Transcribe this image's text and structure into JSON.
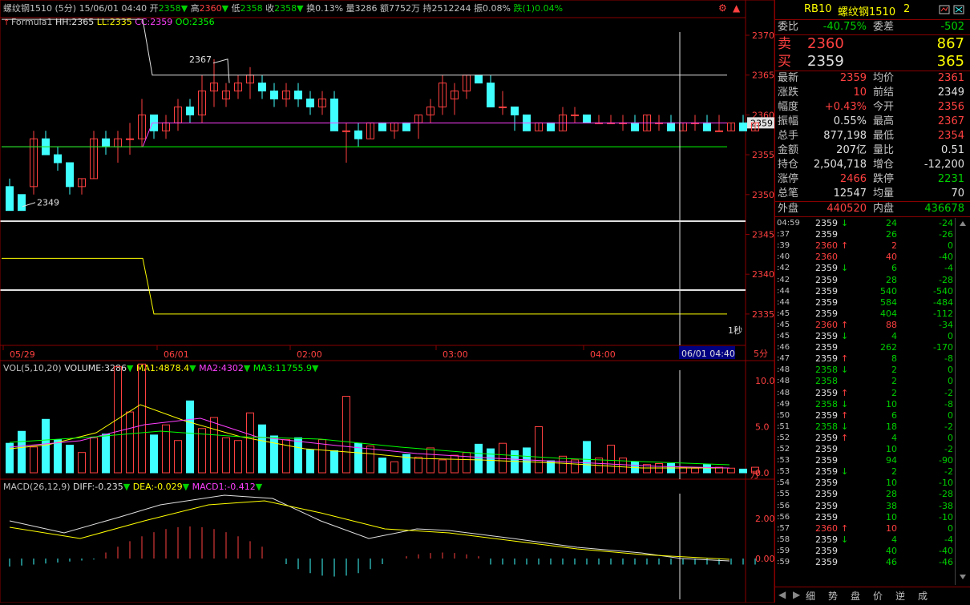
{
  "header": {
    "line1": [
      {
        "t": "螺纹钢1510 (5分)",
        "c": "#c0c0c0"
      },
      {
        "t": " 15/06/01 04:40",
        "c": "#c0c0c0"
      },
      {
        "t": " 开",
        "c": "#c0c0c0"
      },
      {
        "t": "2358",
        "c": "#00d000"
      },
      {
        "t": "▼",
        "c": "#00d000"
      },
      {
        "t": " 高",
        "c": "#c0c0c0"
      },
      {
        "t": "2360",
        "c": "#ff4040"
      },
      {
        "t": "▼",
        "c": "#00d000"
      },
      {
        "t": " 低",
        "c": "#c0c0c0"
      },
      {
        "t": "2358",
        "c": "#00d000"
      },
      {
        "t": " 收",
        "c": "#c0c0c0"
      },
      {
        "t": "2358",
        "c": "#00d000"
      },
      {
        "t": "▼",
        "c": "#00d000"
      },
      {
        "t": " 换0.13%",
        "c": "#c0c0c0"
      },
      {
        "t": " 量3286",
        "c": "#c0c0c0"
      },
      {
        "t": " 额7752万",
        "c": "#c0c0c0"
      },
      {
        "t": " 持2512244",
        "c": "#c0c0c0"
      },
      {
        "t": " 振0.08%",
        "c": "#c0c0c0"
      },
      {
        "t": " 跌(1)0.04%",
        "c": "#00d000"
      }
    ],
    "formula_line": [
      {
        "t": "Formula1 ",
        "c": "#c0c0c0"
      },
      {
        "t": "HH:2365",
        "c": "#e0e0e0"
      },
      {
        "t": " LL:2335",
        "c": "#ffff00"
      },
      {
        "t": " CC:2359",
        "c": "#ff40ff"
      },
      {
        "t": " OO:2356",
        "c": "#00ff00"
      }
    ],
    "vol_line": [
      {
        "t": "VOL(5,10,20) ",
        "c": "#c0c0c0"
      },
      {
        "t": "VOLUME:3286",
        "c": "#e0e0e0"
      },
      {
        "t": "▼",
        "c": "#00d000"
      },
      {
        "t": " MA1:4878.4",
        "c": "#ffff00"
      },
      {
        "t": "▼",
        "c": "#00d000"
      },
      {
        "t": " MA2:4302",
        "c": "#ff40ff"
      },
      {
        "t": "▼",
        "c": "#00d000"
      },
      {
        "t": " MA3:11755.9",
        "c": "#00ff00"
      },
      {
        "t": "▼",
        "c": "#00d000"
      }
    ],
    "macd_line": [
      {
        "t": "MACD(26,12,9) ",
        "c": "#c0c0c0"
      },
      {
        "t": "DIFF:-0.235",
        "c": "#e0e0e0"
      },
      {
        "t": "▼",
        "c": "#00d000"
      },
      {
        "t": " DEA:-0.029",
        "c": "#ffff00"
      },
      {
        "t": "▼",
        "c": "#00d000"
      },
      {
        "t": " MACD1:-0.412",
        "c": "#ff40ff"
      },
      {
        "t": "▼",
        "c": "#00d000"
      }
    ]
  },
  "axes": {
    "price_ticks": [
      "2370",
      "2365",
      "2360",
      "2355",
      "2350",
      "2345",
      "2340",
      "2335"
    ],
    "vol_ticks": [
      "10.0",
      "5.0",
      "0.0"
    ],
    "vol_unit": "万",
    "macd_ticks": [
      "2.00",
      "0.00"
    ],
    "time_labels": [
      "05/29",
      "06/01",
      "02:00",
      "03:00",
      "04:00"
    ],
    "period_label": "5分",
    "cursor_time": "06/01 04:40",
    "current_price_tag": "2359",
    "high_mark": "2367",
    "low_mark": "2349",
    "interval_label": "1秒"
  },
  "chart_data": {
    "type": "candlestick",
    "ylim": [
      2333,
      2372
    ],
    "candles": [
      [
        2351,
        2352,
        2348,
        2348
      ],
      [
        2350,
        2350,
        2348,
        2348
      ],
      [
        2351,
        2358,
        2350,
        2357
      ],
      [
        2357,
        2358,
        2355,
        2355
      ],
      [
        2355,
        2356,
        2353,
        2354
      ],
      [
        2354,
        2354,
        2350,
        2351
      ],
      [
        2351,
        2352,
        2350,
        2352
      ],
      [
        2352,
        2358,
        2352,
        2357
      ],
      [
        2357,
        2358,
        2355,
        2356
      ],
      [
        2356,
        2358,
        2354,
        2357
      ],
      [
        2357,
        2359,
        2355,
        2357
      ],
      [
        2357,
        2362,
        2356,
        2360
      ],
      [
        2360,
        2360,
        2357,
        2358
      ],
      [
        2358,
        2360,
        2357,
        2359
      ],
      [
        2359,
        2362,
        2358,
        2361
      ],
      [
        2361,
        2362,
        2359,
        2360
      ],
      [
        2360,
        2365,
        2359,
        2363
      ],
      [
        2363,
        2367,
        2361,
        2364
      ],
      [
        2362,
        2364,
        2361,
        2363
      ],
      [
        2363,
        2365,
        2362,
        2364
      ],
      [
        2364,
        2366,
        2362,
        2365
      ],
      [
        2364,
        2365,
        2362,
        2363
      ],
      [
        2363,
        2364,
        2361,
        2362
      ],
      [
        2362,
        2364,
        2361,
        2363
      ],
      [
        2363,
        2364,
        2361,
        2362
      ],
      [
        2362,
        2363,
        2360,
        2361
      ],
      [
        2361,
        2363,
        2360,
        2362
      ],
      [
        2362,
        2363,
        2358,
        2358
      ],
      [
        2358,
        2359,
        2354,
        2358
      ],
      [
        2358,
        2359,
        2356,
        2357
      ],
      [
        2357,
        2359,
        2357,
        2359
      ],
      [
        2359,
        2359,
        2358,
        2358
      ],
      [
        2358,
        2359,
        2357,
        2359
      ],
      [
        2359,
        2359,
        2358,
        2358
      ],
      [
        2359,
        2360,
        2357,
        2360
      ],
      [
        2360,
        2362,
        2359,
        2361
      ],
      [
        2361,
        2365,
        2360,
        2364
      ],
      [
        2362,
        2364,
        2360,
        2363
      ],
      [
        2363,
        2365,
        2362,
        2365
      ],
      [
        2365,
        2365,
        2364,
        2364
      ],
      [
        2364,
        2365,
        2361,
        2361
      ],
      [
        2361,
        2363,
        2360,
        2361
      ],
      [
        2361,
        2361,
        2358,
        2360
      ],
      [
        2360,
        2360,
        2358,
        2358
      ],
      [
        2358,
        2359,
        2358,
        2359
      ],
      [
        2359,
        2359,
        2358,
        2358
      ],
      [
        2358,
        2361,
        2358,
        2360
      ],
      [
        2360,
        2361,
        2359,
        2360
      ],
      [
        2360,
        2360,
        2359,
        2359
      ],
      [
        2359,
        2360,
        2359,
        2359
      ],
      [
        2359,
        2360,
        2359,
        2359
      ],
      [
        2359,
        2360,
        2358,
        2359
      ],
      [
        2359,
        2360,
        2358,
        2358
      ],
      [
        2358,
        2360,
        2358,
        2360
      ],
      [
        2359,
        2360,
        2358,
        2359
      ],
      [
        2359,
        2360,
        2358,
        2358
      ],
      [
        2358,
        2359,
        2358,
        2359
      ],
      [
        2359,
        2360,
        2358,
        2359
      ],
      [
        2359,
        2360,
        2358,
        2358
      ],
      [
        2358,
        2360,
        2358,
        2358
      ],
      [
        2358,
        2359,
        2358,
        2359
      ],
      [
        2359,
        2360,
        2358,
        2358
      ],
      [
        2358,
        2359,
        2358,
        2359
      ]
    ],
    "hh": 2365,
    "ll": 2335,
    "cc": 2359,
    "oo": 2356,
    "volume": [
      3.2,
      4.5,
      2.8,
      5.8,
      3.6,
      3.0,
      2.2,
      3.8,
      4.2,
      11.5,
      6.6,
      11.8,
      4.1,
      5.2,
      3.5,
      7.8,
      4.8,
      6.0,
      3.8,
      3.5,
      6.5,
      5.2,
      4.0,
      3.6,
      3.8,
      2.5,
      3.6,
      2.4,
      8.3,
      3.2,
      2.9,
      1.6,
      1.2,
      2.0,
      1.7,
      2.7,
      1.4,
      1.9,
      2.2,
      3.1,
      2.6,
      3.2,
      2.4,
      2.7,
      5.0,
      1.3,
      1.8,
      1.4,
      3.4,
      1.6,
      3.0,
      1.6,
      1.2,
      0.9,
      1.0,
      1.0,
      0.6,
      0.5,
      0.9,
      0.6,
      0.5,
      0.4,
      0.6,
      0.5,
      0.5,
      1.0,
      0.8
    ]
  },
  "right_panel": {
    "code": "RB10",
    "name": "螺纹钢1510",
    "num": "2",
    "weibi_label": "委比",
    "weibi": "-40.75%",
    "weicha_label": "委差",
    "weicha": "-502",
    "sell_label": "卖",
    "sell_price": "2360",
    "sell_vol": "867",
    "buy_label": "买",
    "buy_price": "2359",
    "buy_vol": "365",
    "stats": [
      [
        "最新",
        "2359",
        "red",
        "均价",
        "2361",
        "red"
      ],
      [
        "涨跌",
        "10",
        "red",
        "前结",
        "2349",
        "white"
      ],
      [
        "幅度",
        "+0.43%",
        "red",
        "今开",
        "2356",
        "red"
      ],
      [
        "振幅",
        "0.55%",
        "white",
        "最高",
        "2367",
        "red"
      ],
      [
        "总手",
        "877,198",
        "white",
        "最低",
        "2354",
        "red"
      ],
      [
        "金额",
        "207亿",
        "white",
        "量比",
        "0.51",
        "white"
      ],
      [
        "持仓",
        "2,504,718",
        "white",
        "增仓",
        "-12,200",
        "white"
      ],
      [
        "涨停",
        "2466",
        "red",
        "跌停",
        "2231",
        "green"
      ],
      [
        "总笔",
        "12547",
        "white",
        "均量",
        "70",
        "white"
      ]
    ],
    "waipan_label": "外盘",
    "waipan": "440520",
    "neipan_label": "内盘",
    "neipan": "436678",
    "ticks": [
      [
        "04:59",
        "2359",
        "white",
        "↓",
        "24",
        "-24"
      ],
      [
        ":37",
        "2359",
        "white",
        "",
        "26",
        "-26"
      ],
      [
        ":39",
        "2360",
        "red",
        "↑",
        "2",
        "0"
      ],
      [
        ":40",
        "2360",
        "red",
        "",
        "40",
        "-40"
      ],
      [
        ":42",
        "2359",
        "white",
        "↓",
        "6",
        "-4"
      ],
      [
        ":42",
        "2359",
        "white",
        "",
        "28",
        "-28"
      ],
      [
        ":44",
        "2359",
        "white",
        "",
        "540",
        "-540"
      ],
      [
        ":44",
        "2359",
        "white",
        "",
        "584",
        "-484"
      ],
      [
        ":45",
        "2359",
        "white",
        "",
        "404",
        "-112"
      ],
      [
        ":45",
        "2360",
        "red",
        "↑",
        "88",
        "-34"
      ],
      [
        ":45",
        "2359",
        "white",
        "↓",
        "4",
        "0"
      ],
      [
        ":46",
        "2359",
        "white",
        "",
        "262",
        "-170"
      ],
      [
        ":47",
        "2359",
        "white",
        "↑",
        "8",
        "-8"
      ],
      [
        ":48",
        "2358",
        "green",
        "↓",
        "2",
        "0"
      ],
      [
        ":48",
        "2358",
        "green",
        "",
        "2",
        "0"
      ],
      [
        ":48",
        "2359",
        "white",
        "↑",
        "2",
        "-2"
      ],
      [
        ":49",
        "2358",
        "green",
        "↓",
        "10",
        "-8"
      ],
      [
        ":50",
        "2359",
        "white",
        "↑",
        "6",
        "0"
      ],
      [
        ":51",
        "2358",
        "green",
        "↓",
        "18",
        "-2"
      ],
      [
        ":52",
        "2359",
        "white",
        "↑",
        "4",
        "0"
      ],
      [
        ":52",
        "2359",
        "white",
        "",
        "10",
        "-2"
      ],
      [
        ":53",
        "2359",
        "white",
        "",
        "94",
        "-90"
      ],
      [
        ":53",
        "2359",
        "white",
        "↓",
        "2",
        "-2"
      ],
      [
        ":54",
        "2359",
        "white",
        "",
        "10",
        "-10"
      ],
      [
        ":55",
        "2359",
        "white",
        "",
        "28",
        "-28"
      ],
      [
        ":56",
        "2359",
        "white",
        "",
        "38",
        "-38"
      ],
      [
        ":56",
        "2359",
        "white",
        "",
        "10",
        "-10"
      ],
      [
        ":57",
        "2360",
        "red",
        "↑",
        "10",
        "0"
      ],
      [
        ":58",
        "2359",
        "white",
        "↓",
        "4",
        "-4"
      ],
      [
        ":59",
        "2359",
        "white",
        "",
        "40",
        "-40"
      ],
      [
        ":59",
        "2359",
        "white",
        "",
        "46",
        "-46"
      ]
    ],
    "tabs": [
      "细",
      "势",
      "盘",
      "价",
      "逆",
      "成"
    ]
  },
  "colors": {
    "up": "#ff4040",
    "down": "#40ffff",
    "frame": "#8a0000",
    "hh": "#e0e0e0",
    "ll": "#ffff00",
    "cc": "#ff40ff",
    "oo": "#00ff00"
  }
}
